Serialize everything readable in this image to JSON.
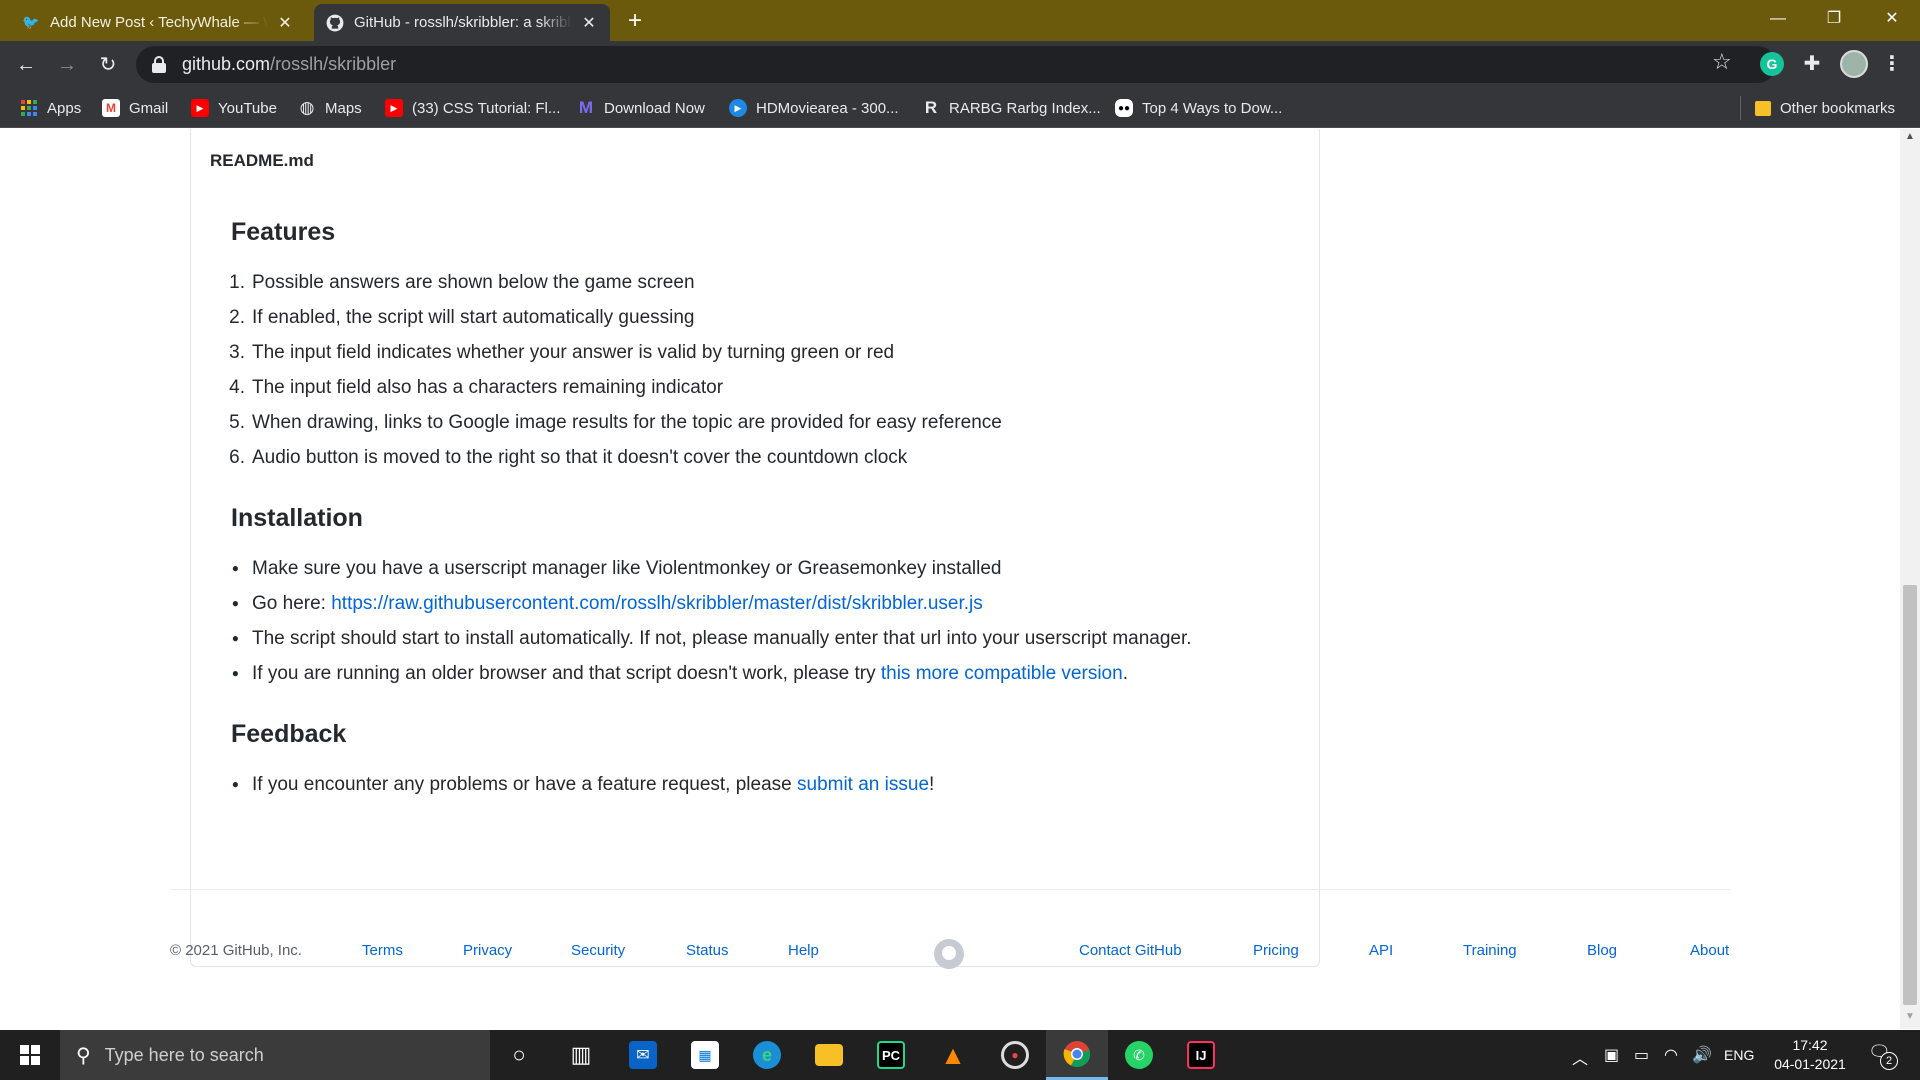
{
  "browser": {
    "tabs": [
      {
        "title": "Add New Post ‹ TechyWhale — WordPress",
        "icon": "wordpress-bird-icon"
      },
      {
        "title": "GitHub - rosslh/skribbler: a skribbl.io tool",
        "icon": "github-icon"
      }
    ],
    "url_domain": "github.com",
    "url_path": "/rosslh/skribbler",
    "bookmarks": [
      {
        "label": "Apps"
      },
      {
        "label": "Gmail"
      },
      {
        "label": "YouTube"
      },
      {
        "label": "Maps"
      },
      {
        "label": "(33) CSS Tutorial: Fl..."
      },
      {
        "label": "Download Now"
      },
      {
        "label": "HDMoviearea - 300..."
      },
      {
        "label": "RARBG Rarbg Index..."
      },
      {
        "label": "Top 4 Ways to Dow..."
      },
      {
        "label": "Other bookmarks"
      }
    ]
  },
  "readme": {
    "filename": "README.md",
    "features_heading": "Features",
    "features": [
      "Possible answers are shown below the game screen",
      "If enabled, the script will start automatically guessing",
      "The input field indicates whether your answer is valid by turning green or red",
      "The input field also has a characters remaining indicator",
      "When drawing, links to Google image results for the topic are provided for easy reference",
      "Audio button is moved to the right so that it doesn't cover the countdown clock"
    ],
    "installation_heading": "Installation",
    "install": {
      "item1": "Make sure you have a userscript manager like Violentmonkey or Greasemonkey installed",
      "item2_prefix": "Go here: ",
      "item2_link": "https://raw.githubusercontent.com/rosslh/skribbler/master/dist/skribbler.user.js",
      "item3": "The script should start to install automatically. If not, please manually enter that url into your userscript manager.",
      "item4_prefix": "If you are running an older browser and that script doesn't work, please try ",
      "item4_link": "this more compatible version",
      "item4_suffix": "."
    },
    "feedback_heading": "Feedback",
    "feedback": {
      "prefix": "If you encounter any problems or have a feature request, please ",
      "link": "submit an issue",
      "suffix": "!"
    }
  },
  "footer": {
    "copyright": "© 2021 GitHub, Inc.",
    "terms": "Terms",
    "privacy": "Privacy",
    "security": "Security",
    "status": "Status",
    "help": "Help",
    "contact": "Contact GitHub",
    "pricing": "Pricing",
    "api": "API",
    "training": "Training",
    "blog": "Blog",
    "about": "About"
  },
  "taskbar": {
    "search_placeholder": "Type here to search",
    "language": "ENG",
    "time": "17:42",
    "date": "04-01-2021",
    "notification_count": "2"
  },
  "colors": {
    "titlebar": "#6b5a0c",
    "toolbar": "#35363a",
    "link": "#0366d6"
  }
}
